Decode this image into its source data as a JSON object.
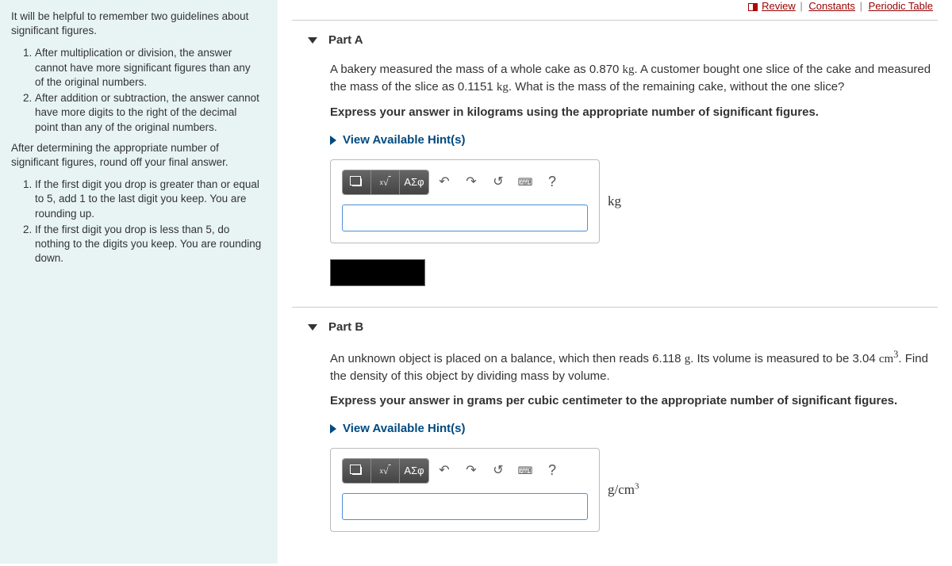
{
  "topLinks": {
    "review": "Review",
    "constants": "Constants",
    "periodic": "Periodic Table"
  },
  "sidebar": {
    "intro": "It will be helpful to remember two guidelines about significant figures.",
    "rule1": "After multiplication or division, the answer cannot have more significant figures than any of the original numbers.",
    "rule2": "After addition or subtraction, the answer cannot have more digits to the right of the decimal point than any of the original numbers.",
    "afterRules": "After determining the appropriate number of significant figures, round off your final answer.",
    "round1": "If the first digit you drop is greater than or equal to 5, add 1 to the last digit you keep. You are rounding up.",
    "round2": "If the first digit you drop is less than 5, do nothing to the digits you keep. You are rounding down."
  },
  "partA": {
    "title": "Part A",
    "q1": "A bakery measured the mass of a whole cake as 0.870 ",
    "q1unit": "kg",
    "q2": ". A customer bought one slice of the cake and measured the mass of the slice as 0.1151 ",
    "q2unit": "kg",
    "q3": ". What is the mass of the remaining cake, without the one slice?",
    "instr": "Express your answer in kilograms using the appropriate number of significant figures.",
    "hints": "View Available Hint(s)",
    "unit": "kg",
    "greek": "ΑΣφ"
  },
  "partB": {
    "title": "Part B",
    "q1": "An unknown object is placed on a balance, which then reads 6.118 ",
    "qunit1": "g",
    "q2": ". Its volume is measured to be 3.04 ",
    "qunit2": "cm",
    "q3": ". Find the density of this object by dividing mass by volume.",
    "instr": "Express your answer in grams per cubic centimeter to the appropriate number of significant figures.",
    "hints": "View Available Hint(s)",
    "unit": "g/cm",
    "greek": "ΑΣφ"
  },
  "tools": {
    "help": "?"
  }
}
